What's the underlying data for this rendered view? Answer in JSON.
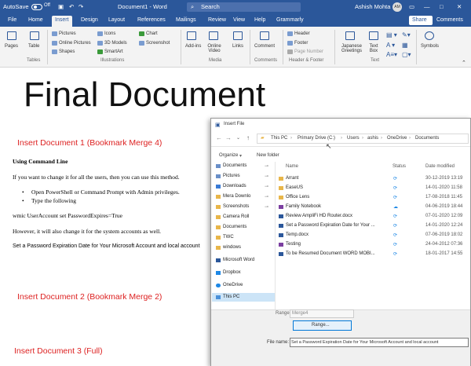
{
  "title_bar": {
    "autosave": "AutoSave",
    "autosave_state": "Off",
    "doc": "Document1 - Word",
    "search": "Search",
    "user": "Ashish Mohta",
    "user_initials": "AM"
  },
  "tabs": [
    "File",
    "Home",
    "Insert",
    "Design",
    "Layout",
    "References",
    "Mailings",
    "Review",
    "View",
    "Help",
    "Grammarly"
  ],
  "share": "Share",
  "comments": "Comments",
  "ribbon": {
    "pages": "Pages",
    "table": "Table",
    "pictures": "Pictures",
    "online_pictures": "Online Pictures",
    "shapes": "Shapes",
    "icons": "Icons",
    "models3d": "3D Models",
    "smartart": "SmartArt",
    "chart": "Chart",
    "screenshot": "Screenshot",
    "addins": "Add-ins",
    "online_video": "Online Video",
    "links": "Links",
    "comment": "Comment",
    "header": "Header",
    "footer": "Footer",
    "page_number": "Page Number",
    "japanese": "Japanese Greetings",
    "textbox": "Text Box",
    "symbols": "Symbols",
    "groups": {
      "tables": "Tables",
      "illustrations": "Illustrations",
      "media": "Media",
      "comments": "Comments",
      "headerfooter": "Header & Footer",
      "text": "Text"
    }
  },
  "document": {
    "heading": "Final Document",
    "ins1": "Insert Document 1 (Bookmark Merge 4)",
    "cmd": "Using Command Line",
    "p1": "If you want to change it for all the users, then you can use this method.",
    "b1": "Open PowerShell or Command Prompt with Admin privileges.",
    "b2": "Type the following",
    "cmd_line": "wmic UserAccount set PasswordExpires=True",
    "p2": "However, it will also change it for the system accounts as well.",
    "p3": "Set a Password Expiration Date for Your Microsoft Account and local account",
    "ins2": "Insert Document 2 (Bookmark Merge 2)",
    "ins3": "Insert Document 3 (Full)"
  },
  "dialog": {
    "title": "Insert File",
    "crumbs": [
      "This PC",
      "Primary Drive (C:)",
      "Users",
      "ashis",
      "OneDrive",
      "Documents"
    ],
    "organize": "Organize",
    "newfolder": "New folder",
    "nav": [
      "Documents",
      "Pictures",
      "Downloads",
      "Mera Downlo",
      "Screenshots",
      "Camera Roll",
      "Documents",
      "TWC",
      "windows",
      "Microsoft Word",
      "Dropbox",
      "OneDrive",
      "This PC"
    ],
    "cols": {
      "name": "Name",
      "status": "Status",
      "date": "Date modified"
    },
    "files": [
      {
        "name": "Arrant",
        "date": "30-12-2019 13:19"
      },
      {
        "name": "EaseUS",
        "date": "14-01-2020 11:58"
      },
      {
        "name": "Office Lens",
        "date": "17-08-2018 11:45"
      },
      {
        "name": "Family Notebook",
        "date": "04-06-2019 18:44"
      },
      {
        "name": "Review AmpliFi HD Router.docx",
        "date": "07-01-2020 12:09"
      },
      {
        "name": "Set a Password Expiration Date for Your ...",
        "date": "14-01-2020 12:24"
      },
      {
        "name": "Temp.docx",
        "date": "07-06-2019 18:02"
      },
      {
        "name": "Testing",
        "date": "24-04-2012 07:36"
      },
      {
        "name": "To be Resumed Document WORD MOBI...",
        "date": "18-01-2017 14:55"
      }
    ],
    "range_label": "Range:",
    "range_value": "Merge4",
    "range_btn": "Range...",
    "filename_label": "File name:",
    "filename_value": "Set a Password Expiration Date for Your Microsoft Account and local account"
  },
  "colors": {
    "word_blue": "#2b579a",
    "red": "#d22222",
    "folder": "#e8b64a"
  }
}
